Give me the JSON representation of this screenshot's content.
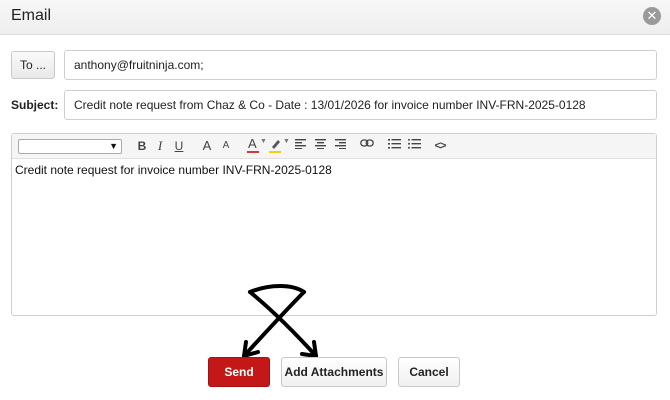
{
  "window": {
    "title": "Email",
    "close_glyph": "✕"
  },
  "recipients": {
    "to_button_label": "To ...",
    "to_value": "anthony@fruitninja.com;"
  },
  "subject": {
    "label": "Subject:",
    "value": "Credit note request from Chaz & Co - Date : 13/01/2026 for invoice number INV-FRN-2025-0128"
  },
  "editor": {
    "body_text": "Credit note request for invoice number INV-FRN-2025-0128",
    "toolbar": {
      "bold": "B",
      "italic": "I",
      "underline": "U",
      "font_size_up": "A",
      "font_size_down": "A",
      "font_color": "A",
      "code_view": "<>"
    },
    "colors": {
      "font_color_bar": "#d33a3a",
      "highlight_bar": "#f2d200"
    }
  },
  "actions": {
    "send_label": "Send",
    "attach_label": "Add Attachments",
    "cancel_label": "Cancel"
  },
  "colors": {
    "send_button": "#c41818"
  }
}
